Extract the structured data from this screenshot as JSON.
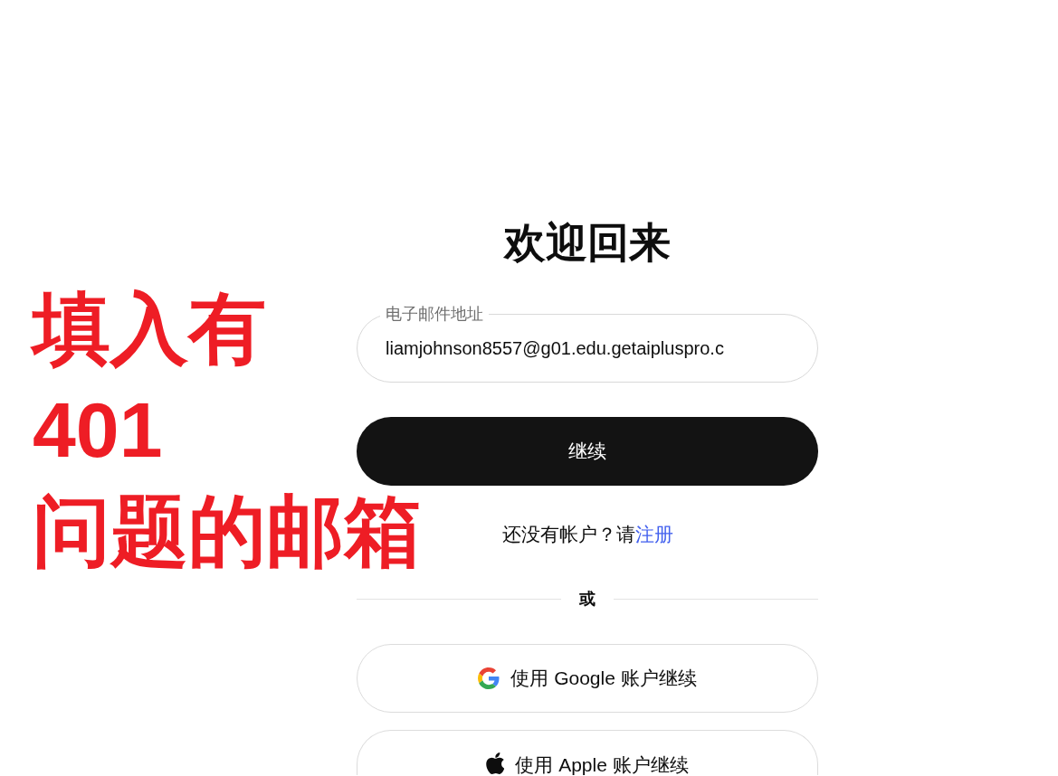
{
  "heading": "欢迎回来",
  "email_field": {
    "label": "电子邮件地址",
    "value": "liamjohnson8557@g01.edu.getaipluspro.c"
  },
  "continue_button": "继续",
  "signup_prompt": {
    "text": "还没有帐户？请",
    "link": "注册"
  },
  "divider": "或",
  "social_buttons": [
    {
      "kind": "google",
      "label": "使用 Google 账户继续"
    },
    {
      "kind": "apple",
      "label": "使用 Apple 账户继续"
    }
  ],
  "annotation": {
    "lines": [
      "填入有",
      "401",
      "问题的邮箱"
    ]
  }
}
